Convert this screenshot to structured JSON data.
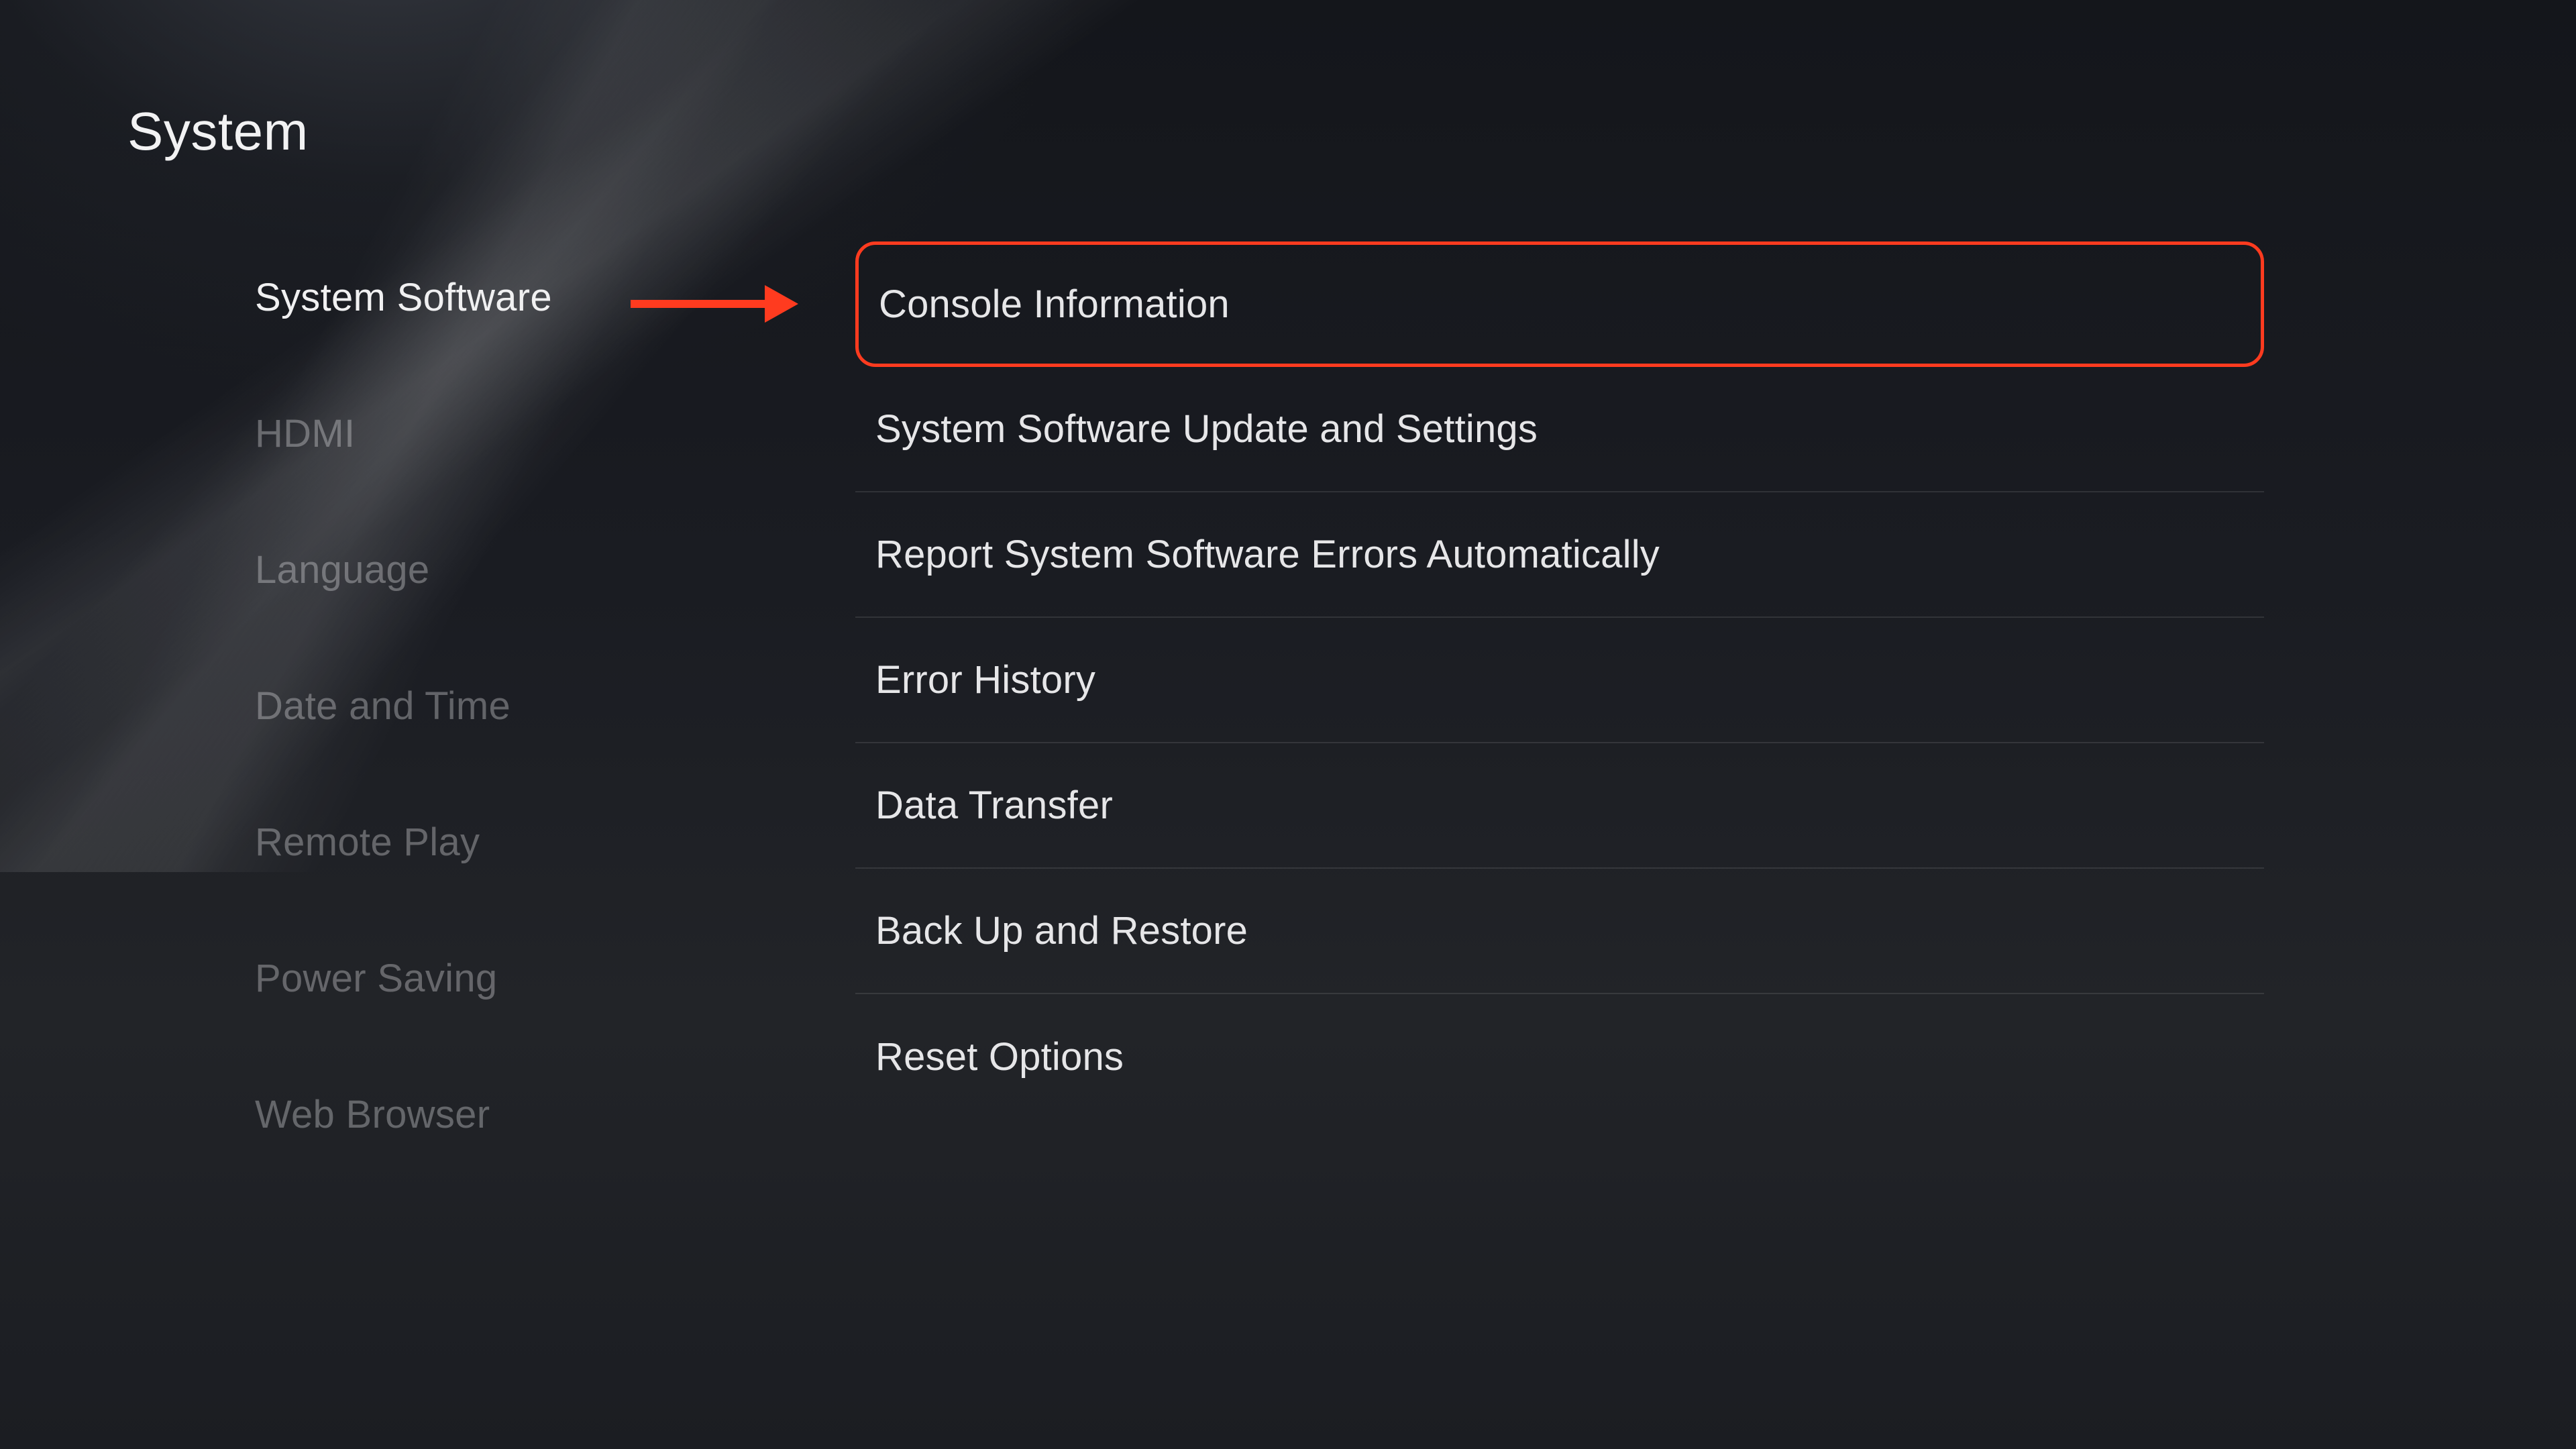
{
  "page": {
    "title": "System"
  },
  "sidebar": {
    "items": [
      {
        "label": "System Software",
        "active": true
      },
      {
        "label": "HDMI",
        "active": false
      },
      {
        "label": "Language",
        "active": false
      },
      {
        "label": "Date and Time",
        "active": false
      },
      {
        "label": "Remote Play",
        "active": false
      },
      {
        "label": "Power Saving",
        "active": false
      },
      {
        "label": "Web Browser",
        "active": false
      }
    ]
  },
  "content": {
    "items": [
      {
        "label": "Console Information",
        "highlighted": true
      },
      {
        "label": "System Software Update and Settings",
        "highlighted": false
      },
      {
        "label": "Report System Software Errors Automatically",
        "highlighted": false
      },
      {
        "label": "Error History",
        "highlighted": false
      },
      {
        "label": "Data Transfer",
        "highlighted": false
      },
      {
        "label": "Back Up and Restore",
        "highlighted": false
      },
      {
        "label": "Reset Options",
        "highlighted": false
      }
    ]
  },
  "annotation": {
    "arrow_color": "#ff3b1f"
  }
}
